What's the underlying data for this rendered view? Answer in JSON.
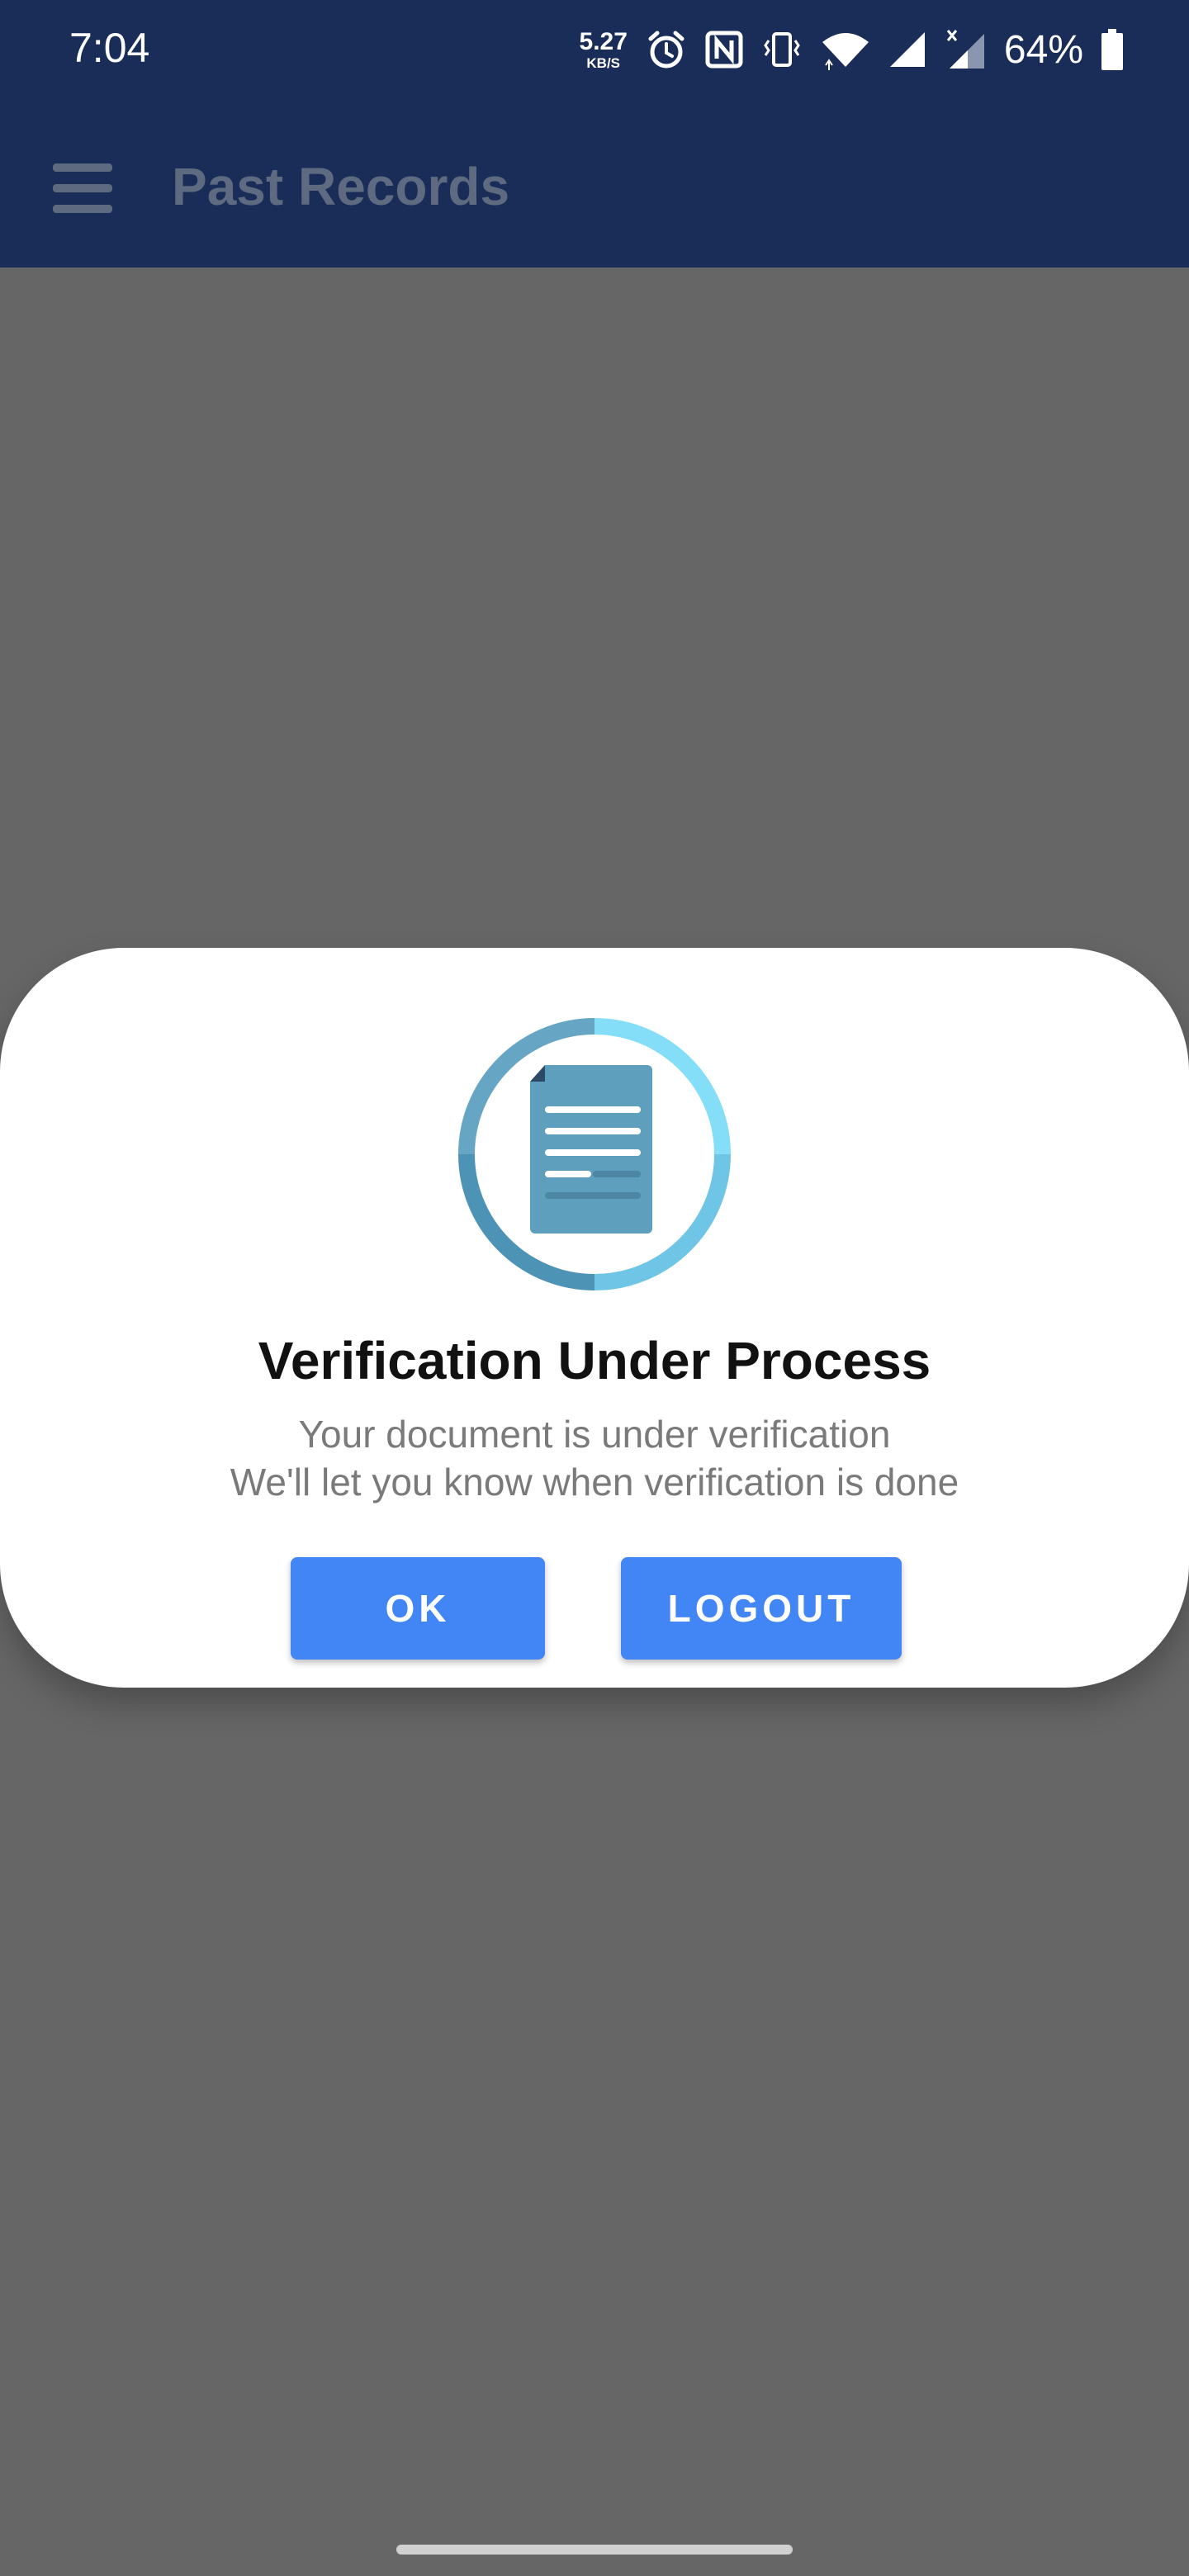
{
  "status_bar": {
    "time": "7:04",
    "net_speed": "5.27",
    "net_speed_unit": "KB/S",
    "battery": "64%",
    "icons": [
      "alarm-icon",
      "nfc-icon",
      "vibrate-icon",
      "wifi-icon",
      "signal-icon",
      "signal-x-icon",
      "battery-icon"
    ]
  },
  "app_bar": {
    "menu_icon": "hamburger-menu-icon",
    "title": "Past Records"
  },
  "dialog": {
    "icon": "document-verification-icon",
    "title": "Verification Under Process",
    "message_line1": "Your document is under verification",
    "message_line2": "We'll let you know when verification is done",
    "ok_label": "OK",
    "logout_label": "LOGOUT"
  },
  "colors": {
    "app_bar": "#1a2d58",
    "title_text": "#5d6a80",
    "scrim": "#666666",
    "button": "#4285f4",
    "icon_ring": "#7fd3f0",
    "icon_doc": "#5e9fbe"
  }
}
